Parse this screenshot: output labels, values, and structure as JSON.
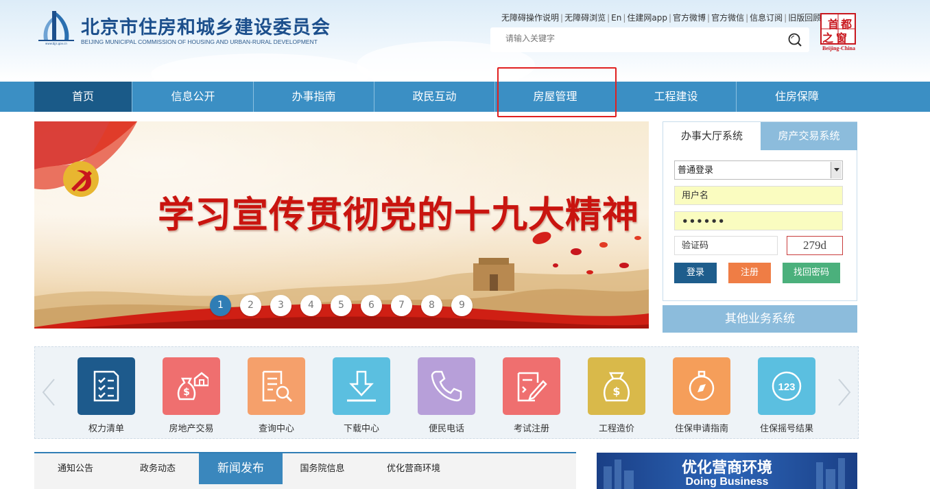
{
  "header": {
    "title": "北京市住房和城乡建设委员会",
    "subtitle": "BEIJING MUNICIPAL COMMISSION OF HOUSING AND URBAN-RURAL DEVELOPMENT",
    "top_links": [
      "无障碍操作说明",
      "无障碍浏览",
      "En",
      "住建网app",
      "官方微博",
      "官方微信",
      "信息订阅",
      "旧版回顾"
    ],
    "search_placeholder": "请输入关键字",
    "capital_logo": {
      "line1": "首都",
      "line2": "之窗",
      "caption": "Beijing-China"
    }
  },
  "nav": {
    "items": [
      "首页",
      "信息公开",
      "办事指南",
      "政民互动",
      "房屋管理",
      "工程建设",
      "住房保障"
    ],
    "active": "首页",
    "highlighted": "房屋管理"
  },
  "banner": {
    "headline": "学习宣传贯彻党的十九大精神",
    "slides": [
      "1",
      "2",
      "3",
      "4",
      "5",
      "6",
      "7",
      "8",
      "9"
    ],
    "active_slide": "1"
  },
  "login": {
    "tabs": [
      "办事大厅系统",
      "房产交易系统"
    ],
    "active_tab": "办事大厅系统",
    "login_type": "普通登录",
    "username_value": "用户名",
    "password_value": "••••••",
    "captcha_placeholder": "验证码",
    "captcha_code": "279d",
    "login_button": "登录",
    "register_button": "注册",
    "recover_button": "找回密码"
  },
  "other_systems": "其他业务系统",
  "shortcuts": [
    {
      "label": "权力清单",
      "color": "#1d5a8c",
      "icon": "checklist-icon"
    },
    {
      "label": "房地产交易",
      "color": "#ef6f6f",
      "icon": "money-bag-house-icon"
    },
    {
      "label": "查询中心",
      "color": "#f5a06b",
      "icon": "document-search-icon"
    },
    {
      "label": "下载中心",
      "color": "#5bbfe0",
      "icon": "download-icon"
    },
    {
      "label": "便民电话",
      "color": "#b79fd9",
      "icon": "phone-icon"
    },
    {
      "label": "考试注册",
      "color": "#ef6f6f",
      "icon": "exam-edit-icon"
    },
    {
      "label": "工程造价",
      "color": "#d9b94a",
      "icon": "money-bag-icon"
    },
    {
      "label": "住保申请指南",
      "color": "#f59e5a",
      "icon": "compass-icon"
    },
    {
      "label": "住保摇号结果",
      "color": "#5bbfe0",
      "icon": "lottery-number-icon"
    }
  ],
  "news": {
    "tabs": [
      "通知公告",
      "政务动态",
      "新闻发布",
      "国务院信息",
      "优化营商环境"
    ],
    "active_tab": "新闻发布"
  },
  "biz_banner": {
    "title": "优化营商环境",
    "subtitle": "Doing Business"
  }
}
